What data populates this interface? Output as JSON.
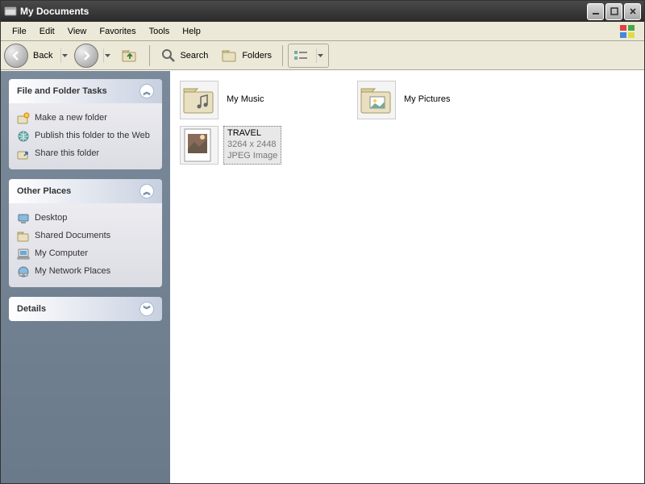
{
  "window": {
    "title": "My Documents"
  },
  "menubar": [
    "File",
    "Edit",
    "View",
    "Favorites",
    "Tools",
    "Help"
  ],
  "toolbar": {
    "back": "Back",
    "search": "Search",
    "folders": "Folders"
  },
  "sidebar": {
    "panels": [
      {
        "title": "File and Folder Tasks",
        "collapsed": false,
        "items": [
          {
            "icon": "new-folder",
            "label": "Make a new folder"
          },
          {
            "icon": "publish",
            "label": "Publish this folder to the Web"
          },
          {
            "icon": "share",
            "label": "Share this folder"
          }
        ]
      },
      {
        "title": "Other Places",
        "collapsed": false,
        "items": [
          {
            "icon": "desktop",
            "label": "Desktop"
          },
          {
            "icon": "folder",
            "label": "Shared Documents"
          },
          {
            "icon": "computer",
            "label": "My Computer"
          },
          {
            "icon": "network",
            "label": "My Network Places"
          }
        ]
      },
      {
        "title": "Details",
        "collapsed": true,
        "items": []
      }
    ]
  },
  "content": {
    "items": [
      {
        "type": "folder-music",
        "name": "My Music",
        "meta1": "",
        "meta2": "",
        "selected": false
      },
      {
        "type": "folder-pictures",
        "name": "My Pictures",
        "meta1": "",
        "meta2": "",
        "selected": false
      },
      {
        "type": "image",
        "name": "TRAVEL",
        "meta1": "3264 x 2448",
        "meta2": "JPEG Image",
        "selected": true
      }
    ]
  }
}
